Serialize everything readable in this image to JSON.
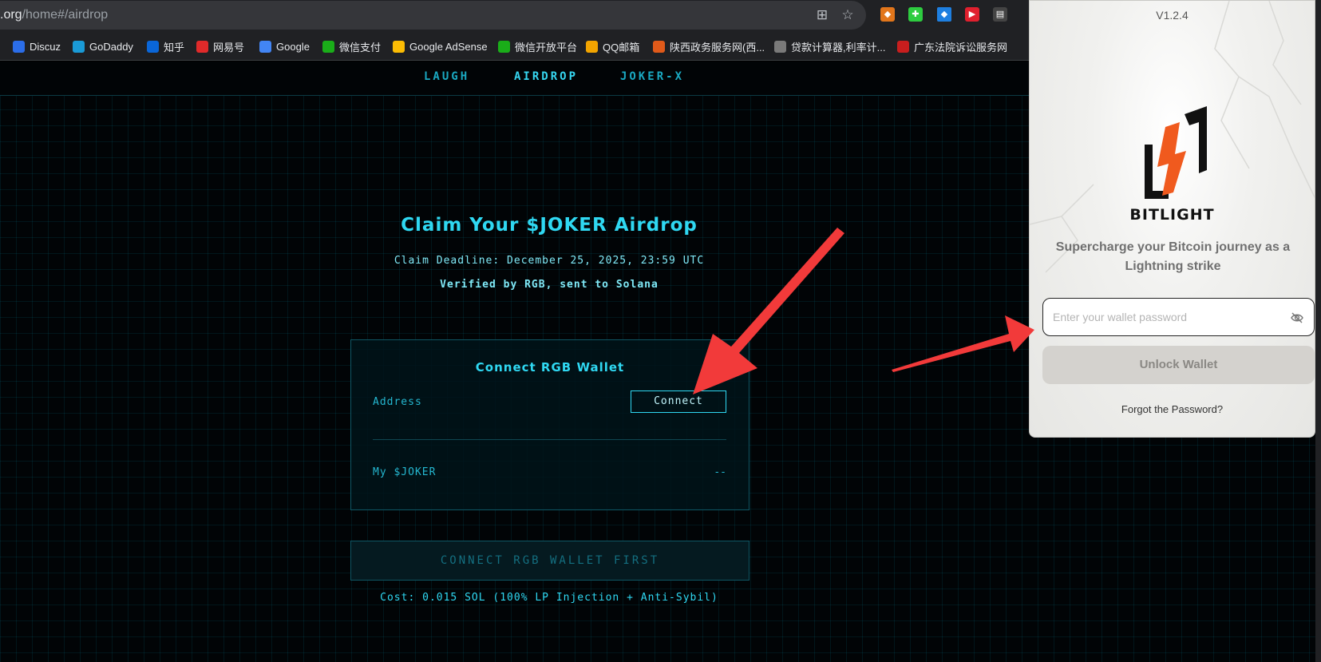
{
  "browser": {
    "url_domain": ".org",
    "url_path": "/home#/airdrop",
    "bookmarks": [
      {
        "label": "Discuz",
        "color": "#2b6de8"
      },
      {
        "label": "GoDaddy",
        "color": "#1a9ad6"
      },
      {
        "label": "知乎",
        "color": "#0a66d8"
      },
      {
        "label": "网易号",
        "color": "#e02a2a"
      },
      {
        "label": "Google",
        "color": "#4285f4"
      },
      {
        "label": "微信支付",
        "color": "#1aad19"
      },
      {
        "label": "Google AdSense",
        "color": "#fbbc04"
      },
      {
        "label": "微信开放平台",
        "color": "#1aad19"
      },
      {
        "label": "QQ邮箱",
        "color": "#f2a400"
      },
      {
        "label": "陕西政务服务网(西...",
        "color": "#e05a1a"
      },
      {
        "label": "贷款计算器,利率计...",
        "color": "#7a7a7a"
      },
      {
        "label": "广东法院诉讼服务网",
        "color": "#c81e1e"
      }
    ]
  },
  "nav": {
    "items": [
      "LAUGH",
      "AIRDROP",
      "JOKER-X"
    ],
    "active": "AIRDROP"
  },
  "hero": {
    "title": "Claim Your $JOKER Airdrop",
    "deadline": "Claim Deadline: December 25, 2025, 23:59 UTC",
    "verified": "Verified by RGB, sent to Solana"
  },
  "card": {
    "title": "Connect RGB Wallet",
    "address_label": "Address",
    "connect_label": "Connect",
    "joker_label": "My $JOKER",
    "joker_value": "--"
  },
  "claim_button": "CONNECT RGB WALLET FIRST",
  "cost": "Cost: 0.015 SOL (100% LP Injection + Anti-Sybil)",
  "wallet": {
    "version": "V1.2.4",
    "brand": "BITLIGHT",
    "tagline": "Supercharge your Bitcoin journey as a Lightning strike",
    "password_placeholder": "Enter your wallet password",
    "unlock_label": "Unlock Wallet",
    "forgot_label": "Forgot the Password?"
  },
  "colors": {
    "accent": "#2fd8f2",
    "arrow": "#f23a3a",
    "logo_orange": "#f05a1e"
  }
}
